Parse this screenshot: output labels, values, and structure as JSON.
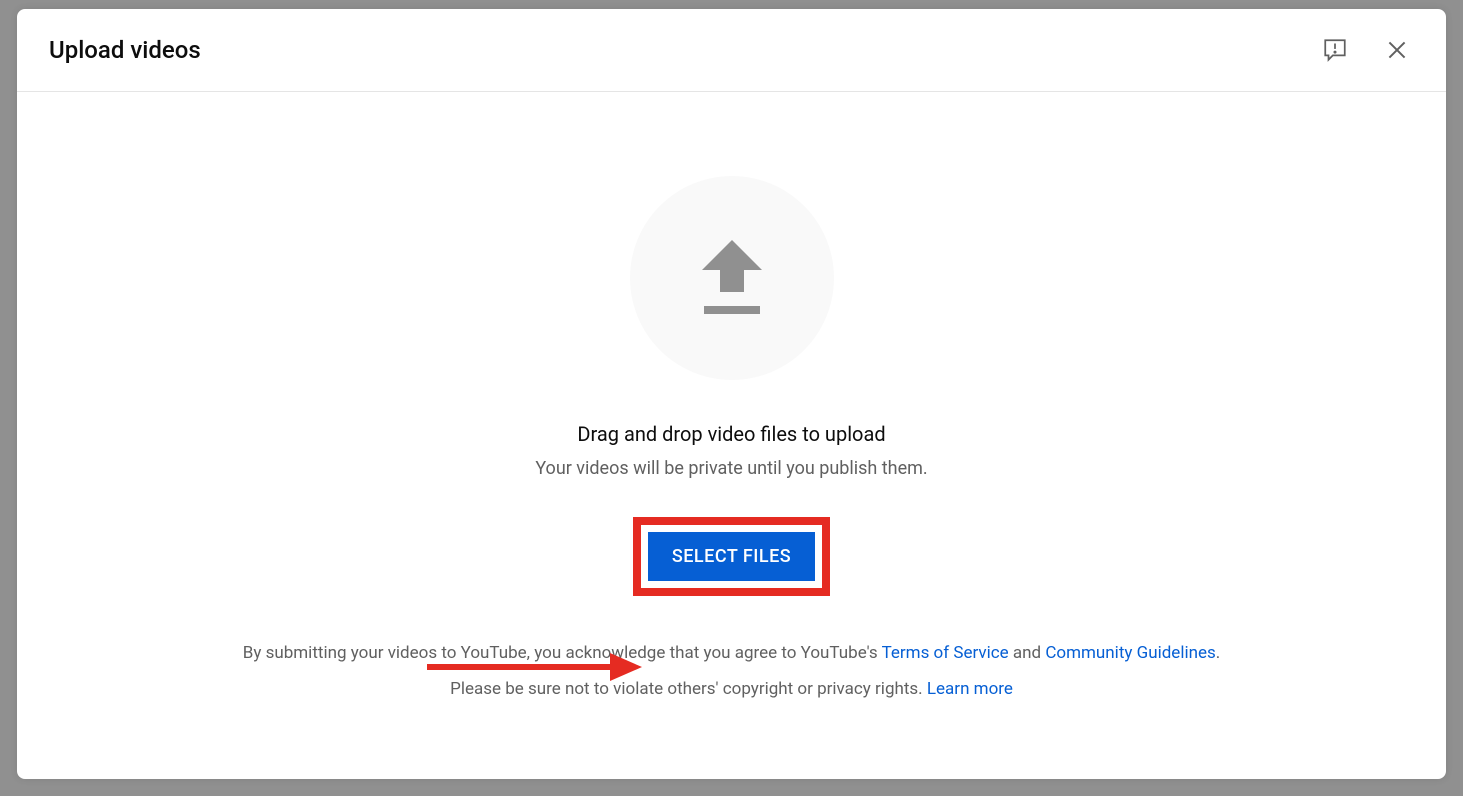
{
  "header": {
    "title": "Upload videos"
  },
  "body": {
    "main_text": "Drag and drop video files to upload",
    "sub_text": "Your videos will be private until you publish them.",
    "select_files_label": "SELECT FILES"
  },
  "footer": {
    "line1_prefix": "By submitting your videos to YouTube, you acknowledge that you agree to YouTube's ",
    "terms_link": "Terms of Service",
    "line1_mid": " and ",
    "guidelines_link": "Community Guidelines",
    "line1_suffix": ".",
    "line2_prefix": "Please be sure not to violate others' copyright or privacy rights. ",
    "learn_more_link": "Learn more"
  }
}
